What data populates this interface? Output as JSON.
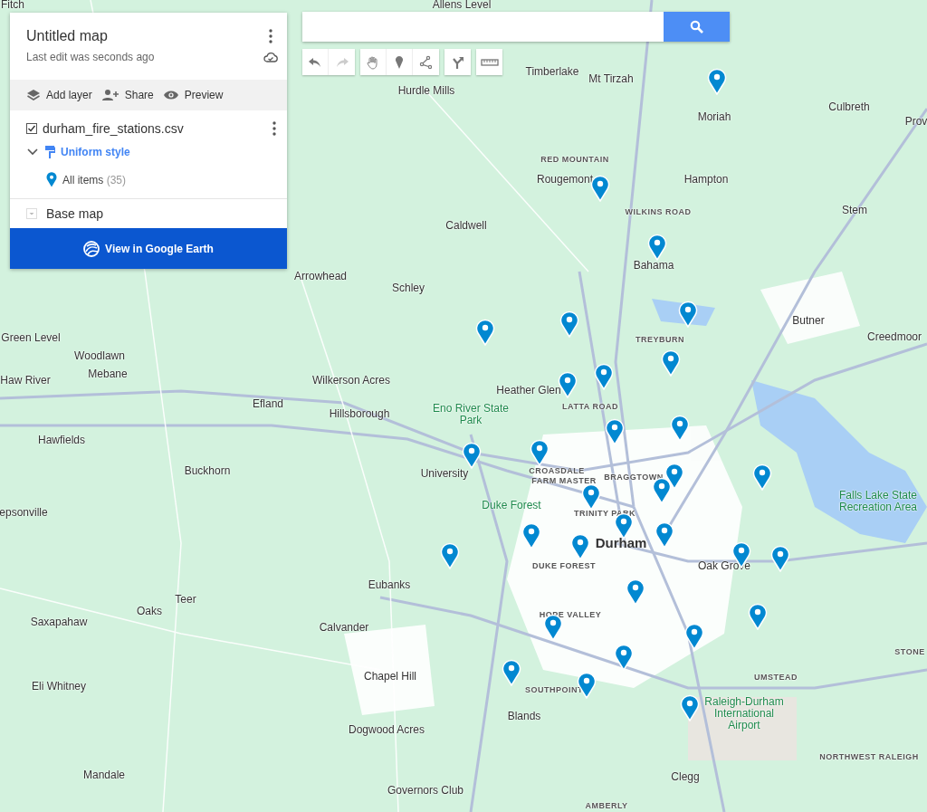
{
  "panel": {
    "title": "Untitled map",
    "subtitle": "Last edit was seconds ago",
    "actions": [
      {
        "kind": "layers",
        "label": "Add layer"
      },
      {
        "kind": "share",
        "label": "Share"
      },
      {
        "kind": "preview",
        "label": "Preview"
      }
    ],
    "layer": {
      "name": "durham_fire_stations.csv",
      "checked": true,
      "expanded": true,
      "style_label": "Uniform style",
      "items_label": "All items",
      "count": "(35)"
    },
    "base_map": {
      "label": "Base map",
      "expanded": false
    },
    "earth_button": "View in Google Earth"
  },
  "tools": [
    {
      "kind": "undo",
      "disabled": false
    },
    {
      "kind": "redo",
      "disabled": true
    },
    {
      "kind": "hand",
      "disabled": false
    },
    {
      "kind": "marker",
      "disabled": false
    },
    {
      "kind": "line",
      "disabled": false
    },
    {
      "kind": "directions",
      "disabled": false
    },
    {
      "kind": "ruler",
      "disabled": false
    }
  ],
  "map_labels": [
    {
      "text": "Fitch",
      "kind": "town"
    },
    {
      "text": "Allens Level",
      "kind": "town"
    },
    {
      "text": "Timberlake",
      "kind": "town"
    },
    {
      "text": "Mt Tirzah",
      "kind": "town"
    },
    {
      "text": "Moriah",
      "kind": "town"
    },
    {
      "text": "Culbreth",
      "kind": "town"
    },
    {
      "text": "Prov",
      "kind": "town"
    },
    {
      "text": "Hurdle Mills",
      "kind": "town"
    },
    {
      "text": "RED MOUNTAIN",
      "kind": "district"
    },
    {
      "text": "Rougemont",
      "kind": "town"
    },
    {
      "text": "Hampton",
      "kind": "town"
    },
    {
      "text": "WILKINS ROAD",
      "kind": "district"
    },
    {
      "text": "Stem",
      "kind": "town"
    },
    {
      "text": "Caldwell",
      "kind": "town"
    },
    {
      "text": "Bahama",
      "kind": "town"
    },
    {
      "text": "Arrowhead",
      "kind": "town"
    },
    {
      "text": "Schley",
      "kind": "town"
    },
    {
      "text": "Butner",
      "kind": "town"
    },
    {
      "text": "Green Level",
      "kind": "town"
    },
    {
      "text": "TREYBURN",
      "kind": "district"
    },
    {
      "text": "Creedmoor",
      "kind": "town"
    },
    {
      "text": "Woodlawn",
      "kind": "town"
    },
    {
      "text": "Mebane",
      "kind": "town"
    },
    {
      "text": "Haw River",
      "kind": "town"
    },
    {
      "text": "Wilkerson Acres",
      "kind": "town"
    },
    {
      "text": "Heather Glen",
      "kind": "town"
    },
    {
      "text": "Efland",
      "kind": "town"
    },
    {
      "text": "Hillsborough",
      "kind": "town"
    },
    {
      "text": "Eno River State Park",
      "kind": "park"
    },
    {
      "text": "LATTA ROAD",
      "kind": "district"
    },
    {
      "text": "Hawfields",
      "kind": "town"
    },
    {
      "text": "Buckhorn",
      "kind": "town"
    },
    {
      "text": "University",
      "kind": "town"
    },
    {
      "text": "CROASDALE",
      "kind": "district"
    },
    {
      "text": "FARM MASTER",
      "kind": "district"
    },
    {
      "text": "BRAGGTOWN",
      "kind": "district"
    },
    {
      "text": "Duke Forest",
      "kind": "park"
    },
    {
      "text": "TRINITY PARK",
      "kind": "district"
    },
    {
      "text": "Durham",
      "kind": "city"
    },
    {
      "text": "DUKE FOREST",
      "kind": "district"
    },
    {
      "text": "Oak Grove",
      "kind": "town"
    },
    {
      "text": "Falls Lake State Recreation Area",
      "kind": "park"
    },
    {
      "text": "epsonville",
      "kind": "town"
    },
    {
      "text": "Eubanks",
      "kind": "town"
    },
    {
      "text": "Teer",
      "kind": "town"
    },
    {
      "text": "Oaks",
      "kind": "town"
    },
    {
      "text": "Saxapahaw",
      "kind": "town"
    },
    {
      "text": "HOPE VALLEY",
      "kind": "district"
    },
    {
      "text": "Calvander",
      "kind": "town"
    },
    {
      "text": "STONE",
      "kind": "district"
    },
    {
      "text": "UMSTEAD",
      "kind": "district"
    },
    {
      "text": "Chapel Hill",
      "kind": "town"
    },
    {
      "text": "Eli Whitney",
      "kind": "town"
    },
    {
      "text": "SOUTHPOINT",
      "kind": "district"
    },
    {
      "text": "Blands",
      "kind": "town"
    },
    {
      "text": "Raleigh-Durham International Airport",
      "kind": "park"
    },
    {
      "text": "Dogwood Acres",
      "kind": "town"
    },
    {
      "text": "NORTHWEST RALEIGH",
      "kind": "district"
    },
    {
      "text": "Clegg",
      "kind": "town"
    },
    {
      "text": "Mandale",
      "kind": "town"
    },
    {
      "text": "Governors Club",
      "kind": "town"
    },
    {
      "text": "AMBERLY",
      "kind": "district"
    }
  ]
}
